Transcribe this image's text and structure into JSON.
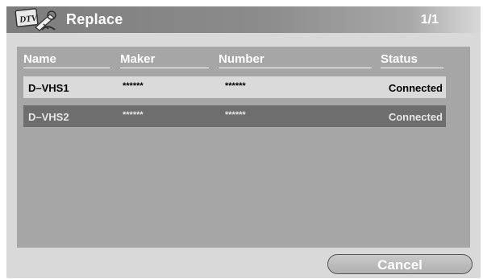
{
  "window": {
    "title": "Replace",
    "page_indicator": "1/1",
    "icon": "dtv-tools-icon",
    "icon_text": "DTV"
  },
  "columns": [
    "Name",
    "Maker",
    "Number",
    "Status"
  ],
  "devices": [
    {
      "name": "D–VHS1",
      "maker": "******",
      "number": "******",
      "status": "Connected",
      "selected": false
    },
    {
      "name": "D–VHS2",
      "maker": "******",
      "number": "******",
      "status": "Connected",
      "selected": true
    }
  ],
  "buttons": {
    "cancel_label": "Cancel"
  },
  "colors": {
    "dialog_bg": "#d9d9d9",
    "title_bar": "#8c8c8c",
    "list_bg": "#a6a6a6",
    "row_bg": "#dadada",
    "selected_row_bg": "#6e6e6e"
  }
}
